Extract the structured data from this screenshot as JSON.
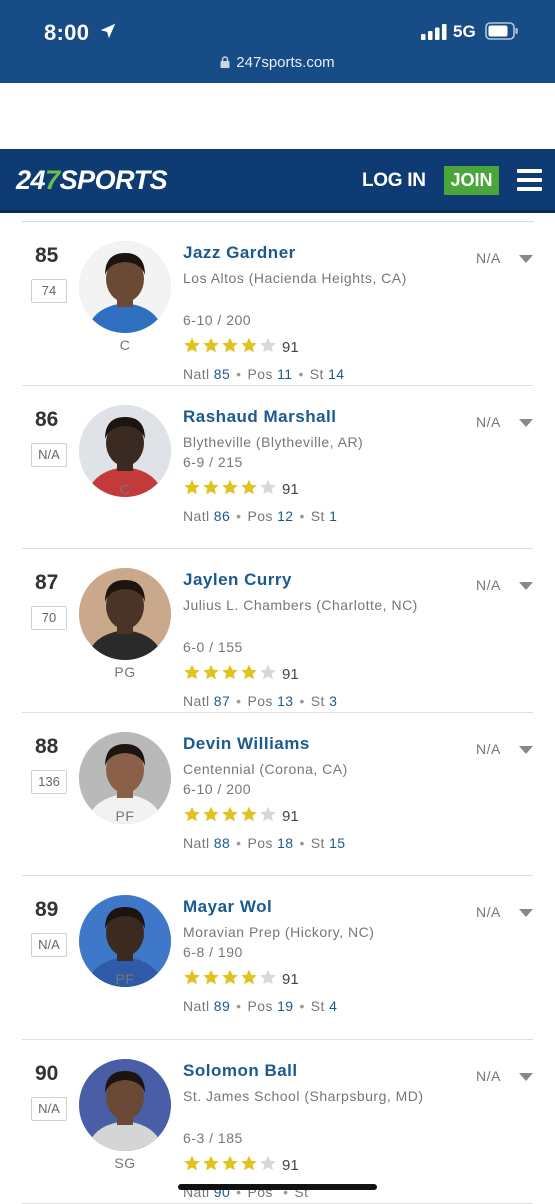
{
  "status_bar": {
    "time": "8:00",
    "network": "5G",
    "url": "247sports.com"
  },
  "header": {
    "logo_part1": "24",
    "logo_part2": "7",
    "logo_part3": "SPORTS",
    "login_label": "LOG IN",
    "join_label": "JOIN"
  },
  "colors": {
    "header_bg": "#0e3b73",
    "join_bg": "#4aa63a",
    "link": "#1b5a8f",
    "star": "#e0c31f"
  },
  "players": [
    {
      "rank": "85",
      "prev_rank": "74",
      "position": "C",
      "name": "Jazz Gardner",
      "school": "Los Altos (Hacienda Heights, CA)",
      "height_weight": "6-10 / 200",
      "stars": 4,
      "rating": "91",
      "natl": "85",
      "pos_rank": "11",
      "st_rank": "14",
      "status": "N/A"
    },
    {
      "rank": "86",
      "prev_rank": "N/A",
      "position": "C",
      "name": "Rashaud Marshall",
      "school": "Blytheville (Blytheville, AR)",
      "height_weight": "6-9 / 215",
      "stars": 4,
      "rating": "91",
      "natl": "86",
      "pos_rank": "12",
      "st_rank": "1",
      "status": "N/A"
    },
    {
      "rank": "87",
      "prev_rank": "70",
      "position": "PG",
      "name": "Jaylen Curry",
      "school": "Julius L. Chambers (Charlotte, NC)",
      "height_weight": "6-0 / 155",
      "stars": 4,
      "rating": "91",
      "natl": "87",
      "pos_rank": "13",
      "st_rank": "3",
      "status": "N/A"
    },
    {
      "rank": "88",
      "prev_rank": "136",
      "position": "PF",
      "name": "Devin Williams",
      "school": "Centennial (Corona, CA)",
      "height_weight": "6-10 / 200",
      "stars": 4,
      "rating": "91",
      "natl": "88",
      "pos_rank": "18",
      "st_rank": "15",
      "status": "N/A"
    },
    {
      "rank": "89",
      "prev_rank": "N/A",
      "position": "PF",
      "name": "Mayar Wol",
      "school": "Moravian Prep (Hickory, NC)",
      "height_weight": "6-8 / 190",
      "stars": 4,
      "rating": "91",
      "natl": "89",
      "pos_rank": "19",
      "st_rank": "4",
      "status": "N/A"
    },
    {
      "rank": "90",
      "prev_rank": "N/A",
      "position": "SG",
      "name": "Solomon Ball",
      "school": "St. James School (Sharpsburg, MD)",
      "height_weight": "6-3 / 185",
      "stars": 4,
      "rating": "91",
      "natl": "90",
      "pos_rank": "",
      "st_rank": "",
      "status": "N/A"
    }
  ],
  "labels": {
    "natl": "Natl",
    "pos": "Pos",
    "st": "St"
  }
}
